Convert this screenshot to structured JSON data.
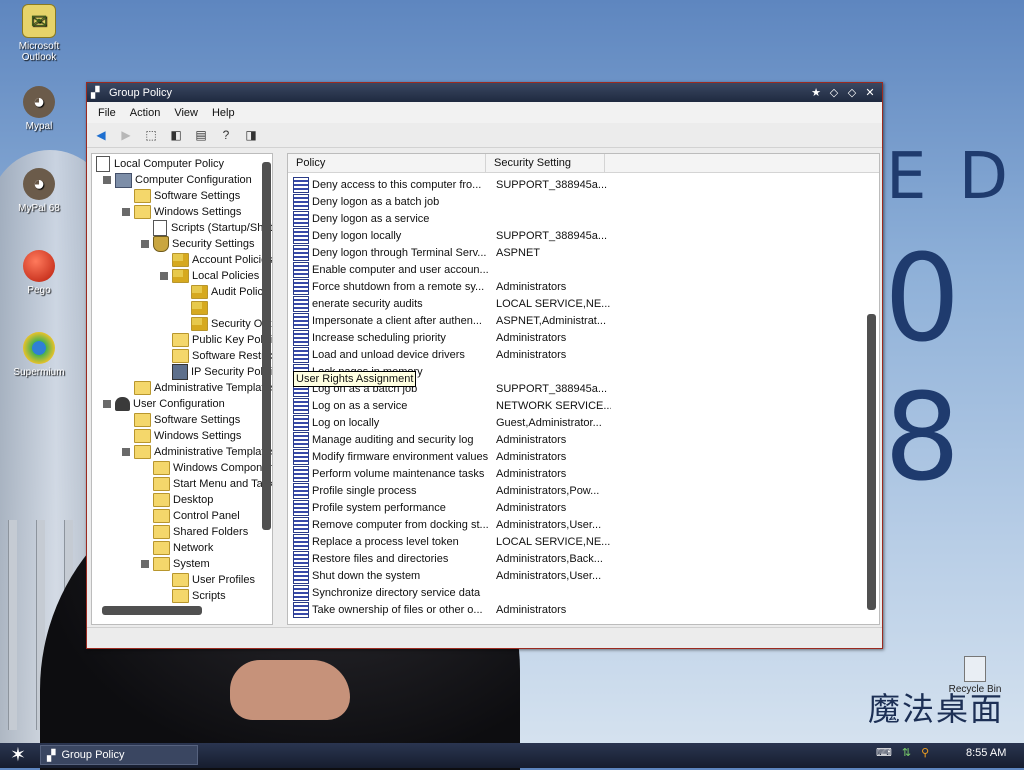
{
  "desktop": {
    "icons": [
      {
        "label": "Microsoft Outlook",
        "icon": "outlook-icon"
      },
      {
        "label": "Mypal",
        "icon": "raccoon-icon"
      },
      {
        "label": "MyPal 68",
        "icon": "raccoon-icon"
      },
      {
        "label": "Pego",
        "icon": "red-orb-icon"
      },
      {
        "label": "Supermium",
        "icon": "globe-icon"
      }
    ],
    "background_text_1": "E D",
    "background_text_2": "0 8",
    "logo_text": "魔法桌面",
    "recycle_bin_label": "Recycle Bin"
  },
  "window": {
    "title": "Group Policy",
    "menu": [
      "File",
      "Action",
      "View",
      "Help"
    ],
    "tooltip": "User Rights Assignment",
    "tree": [
      {
        "label": "Local Computer Policy",
        "indent": 0,
        "icon": "script"
      },
      {
        "label": "Computer Configuration",
        "indent": 1,
        "icon": "pc",
        "expander": true
      },
      {
        "label": "Software Settings",
        "indent": 2,
        "icon": "folder",
        "expander": false
      },
      {
        "label": "Windows Settings",
        "indent": 2,
        "icon": "folder",
        "expander": true
      },
      {
        "label": "Scripts (Startup/Shut",
        "indent": 3,
        "icon": "script",
        "expander": false
      },
      {
        "label": "Security Settings",
        "indent": 3,
        "icon": "shield",
        "expander": true
      },
      {
        "label": "Account Policies",
        "indent": 4,
        "icon": "lockfolder",
        "expander": false
      },
      {
        "label": "Local Policies",
        "indent": 4,
        "icon": "lockfolder",
        "expander": true
      },
      {
        "label": "Audit Policy",
        "indent": 5,
        "icon": "lockfolder",
        "expander": false
      },
      {
        "label": "",
        "indent": 5,
        "icon": "lockfolder",
        "expander": false
      },
      {
        "label": "Security Opt",
        "indent": 5,
        "icon": "lockfolder",
        "expander": false
      },
      {
        "label": "Public Key Policie",
        "indent": 4,
        "icon": "folder",
        "expander": false
      },
      {
        "label": "Software Restric",
        "indent": 4,
        "icon": "folder",
        "expander": false
      },
      {
        "label": "IP Security Polici",
        "indent": 4,
        "icon": "ips",
        "expander": false
      },
      {
        "label": "Administrative Templates",
        "indent": 2,
        "icon": "folder",
        "expander": false
      },
      {
        "label": "User Configuration",
        "indent": 1,
        "icon": "user",
        "expander": true
      },
      {
        "label": "Software Settings",
        "indent": 2,
        "icon": "folder",
        "expander": false
      },
      {
        "label": "Windows Settings",
        "indent": 2,
        "icon": "folder",
        "expander": false
      },
      {
        "label": "Administrative Templates",
        "indent": 2,
        "icon": "folder",
        "expander": true
      },
      {
        "label": "Windows Component",
        "indent": 3,
        "icon": "folder",
        "expander": false
      },
      {
        "label": "Start Menu and Task",
        "indent": 3,
        "icon": "folder",
        "expander": false
      },
      {
        "label": "Desktop",
        "indent": 3,
        "icon": "folder",
        "expander": false
      },
      {
        "label": "Control Panel",
        "indent": 3,
        "icon": "folder",
        "expander": false
      },
      {
        "label": "Shared Folders",
        "indent": 3,
        "icon": "folder",
        "expander": false
      },
      {
        "label": "Network",
        "indent": 3,
        "icon": "folder",
        "expander": false
      },
      {
        "label": "System",
        "indent": 3,
        "icon": "folder",
        "expander": true
      },
      {
        "label": "User Profiles",
        "indent": 4,
        "icon": "folder",
        "expander": false
      },
      {
        "label": "Scripts",
        "indent": 4,
        "icon": "folder",
        "expander": false
      }
    ],
    "list": {
      "columns": [
        "Policy",
        "Security Setting"
      ],
      "rows": [
        [
          "Deny access to this computer fro...",
          "SUPPORT_388945a..."
        ],
        [
          "Deny logon as a batch job",
          ""
        ],
        [
          "Deny logon as a service",
          ""
        ],
        [
          "Deny logon locally",
          "SUPPORT_388945a..."
        ],
        [
          "Deny logon through Terminal Serv...",
          "ASPNET"
        ],
        [
          "Enable computer and user accoun...",
          ""
        ],
        [
          "Force shutdown from a remote sy...",
          "Administrators"
        ],
        [
          "enerate security audits",
          "LOCAL SERVICE,NE..."
        ],
        [
          "Impersonate a client after authen...",
          "ASPNET,Administrat..."
        ],
        [
          "Increase scheduling priority",
          "Administrators"
        ],
        [
          "Load and unload device drivers",
          "Administrators"
        ],
        [
          "Lock pages in memory",
          ""
        ],
        [
          "Log on as a batch job",
          "SUPPORT_388945a..."
        ],
        [
          "Log on as a service",
          "NETWORK SERVICE..."
        ],
        [
          "Log on locally",
          "Guest,Administrator..."
        ],
        [
          "Manage auditing and security log",
          "Administrators"
        ],
        [
          "Modify firmware environment values",
          "Administrators"
        ],
        [
          "Perform volume maintenance tasks",
          "Administrators"
        ],
        [
          "Profile single process",
          "Administrators,Pow..."
        ],
        [
          "Profile system performance",
          "Administrators"
        ],
        [
          "Remove computer from docking st...",
          "Administrators,User..."
        ],
        [
          "Replace a process level token",
          "LOCAL SERVICE,NE..."
        ],
        [
          "Restore files and directories",
          "Administrators,Back..."
        ],
        [
          "Shut down the system",
          "Administrators,User..."
        ],
        [
          "Synchronize directory service data",
          ""
        ],
        [
          "Take ownership of files or other o...",
          "Administrators"
        ]
      ]
    }
  },
  "taskbar": {
    "task_label": "Group Policy",
    "clock": "8:55 AM"
  },
  "colors": {
    "titlebar": "#1f2a40",
    "window_border": "#9b2a20",
    "taskbar": "#161d2e",
    "tooltip_bg": "#ffffe1"
  }
}
